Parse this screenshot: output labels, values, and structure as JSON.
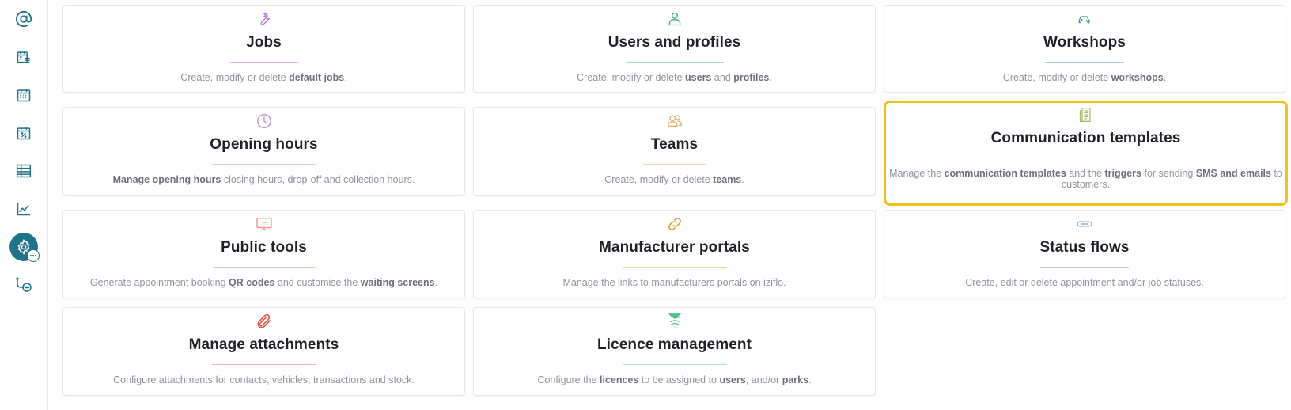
{
  "colors": {
    "sidebar_icon": "#21738a",
    "active_nav_bg": "#21738a",
    "highlight_border": "#f2c21b"
  },
  "sidebar": {
    "items": [
      {
        "icon": "at-sign-icon"
      },
      {
        "icon": "calendar-list-icon"
      },
      {
        "icon": "calendar-grid-icon"
      },
      {
        "icon": "calendar-percent-icon"
      },
      {
        "icon": "table-icon"
      },
      {
        "icon": "line-chart-icon"
      },
      {
        "icon": "settings-gear-icon",
        "active": true
      },
      {
        "icon": "flow-more-icon"
      }
    ]
  },
  "cards": {
    "jobs": {
      "title": "Jobs",
      "icon": "wrench-icon",
      "color": "#b26fd6",
      "desc": [
        {
          "t": "Create, modify or delete "
        },
        {
          "t": "default jobs",
          "b": true
        },
        {
          "t": "."
        }
      ]
    },
    "users": {
      "title": "Users and profiles",
      "icon": "user-icon",
      "color": "#3fb391",
      "desc": [
        {
          "t": "Create, modify or delete "
        },
        {
          "t": "users",
          "b": true
        },
        {
          "t": " and "
        },
        {
          "t": "profiles",
          "b": true
        },
        {
          "t": "."
        }
      ]
    },
    "workshops": {
      "title": "Workshops",
      "icon": "car-repair-icon",
      "color": "#2f8f9d",
      "desc": [
        {
          "t": "Create, modify or delete "
        },
        {
          "t": "workshops",
          "b": true
        },
        {
          "t": "."
        }
      ]
    },
    "opening": {
      "title": "Opening hours",
      "icon": "clock-icon",
      "color": "#c08ad9",
      "desc": [
        {
          "t": "Manage opening hours",
          "b": true
        },
        {
          "t": " closing hours, drop-off and collection hours."
        }
      ]
    },
    "teams": {
      "title": "Teams",
      "icon": "team-icon",
      "color": "#e3ad63",
      "desc": [
        {
          "t": "Create, modify or delete "
        },
        {
          "t": "teams",
          "b": true
        },
        {
          "t": "."
        }
      ]
    },
    "comm": {
      "title": "Communication templates",
      "icon": "document-template-icon",
      "color": "#9dbf6a",
      "desc": [
        {
          "t": "Manage the "
        },
        {
          "t": "communication templates",
          "b": true
        },
        {
          "t": " and the "
        },
        {
          "t": "triggers",
          "b": true
        },
        {
          "t": " for sending "
        },
        {
          "t": "SMS and emails",
          "b": true
        },
        {
          "t": " to customers."
        }
      ]
    },
    "public": {
      "title": "Public tools",
      "icon": "monitor-icon",
      "color": "#f08a7a",
      "desc": [
        {
          "t": "Generate appointment booking "
        },
        {
          "t": "QR codes",
          "b": true
        },
        {
          "t": " and customise the "
        },
        {
          "t": "waiting screens",
          "b": true
        },
        {
          "t": "."
        }
      ]
    },
    "portals": {
      "title": "Manufacturer portals",
      "icon": "link-icon",
      "color": "#e1a235",
      "desc": [
        {
          "t": "Manage the links to manufacturers portals on iziflo."
        }
      ]
    },
    "status": {
      "title": "Status flows",
      "icon": "status-pill-icon",
      "color": "#5fa3b8",
      "desc": [
        {
          "t": "Create, edit or delete appointment and/or job statuses."
        }
      ]
    },
    "attach": {
      "title": "Manage attachments",
      "icon": "paperclip-icon",
      "color": "#e2574c",
      "desc": [
        {
          "t": "Configure attachments for contacts, vehicles, transactions and stock."
        }
      ]
    },
    "licence": {
      "title": "Licence management",
      "icon": "licence-icon",
      "color": "#4fbf8f",
      "desc": [
        {
          "t": "Configure the "
        },
        {
          "t": "licences",
          "b": true
        },
        {
          "t": " to be assigned to "
        },
        {
          "t": "users",
          "b": true
        },
        {
          "t": ", and/or "
        },
        {
          "t": "parks",
          "b": true
        },
        {
          "t": "."
        }
      ]
    }
  }
}
